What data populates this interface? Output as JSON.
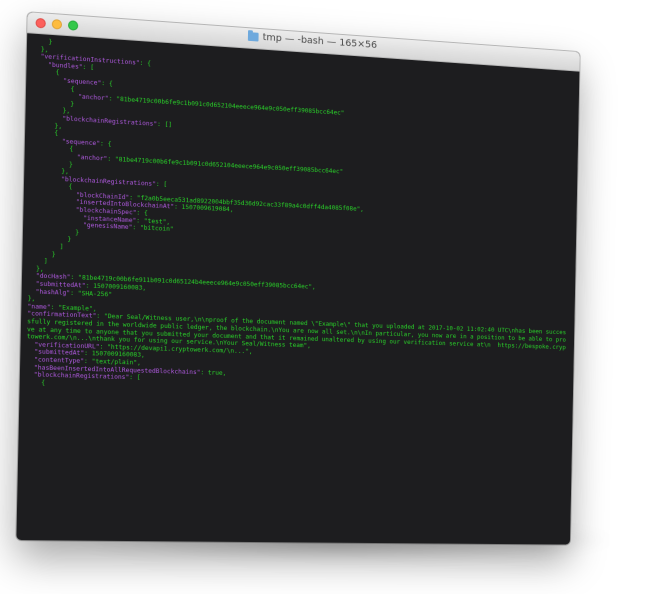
{
  "window": {
    "title": "tmp — -bash — 165×56",
    "icon": "folder-icon",
    "controls": [
      "close",
      "minimize",
      "zoom"
    ]
  },
  "colors": {
    "background": "#1d1d1f",
    "text_green": "#2ad32a",
    "key_purple": "#b05ae0"
  },
  "terminal_lines": [
    "    }",
    "  },",
    "  \"verificationInstructions\": {",
    "    \"bundles\": [",
    "      {",
    "        \"sequence\": {",
    "          {",
    "            \"anchor\": \"81be4719c00b6fe9c1b091c0d652104eeece964e9c050eff39085bcc64ec\"",
    "          }",
    "        },",
    "        \"blockchainRegistrations\": []",
    "      },",
    "      {",
    "        \"sequence\": {",
    "          {",
    "            \"anchor\": \"81be4719c00b6fe9c1b091c0d652104eeece964e9c050eff39085bcc64ec\"",
    "          }",
    "        },",
    "        \"blockchainRegistrations\": [",
    "          {",
    "            \"blockChainId\": \"f2a0b5eeca531ad8922004bbf35d36d92cac33f89a4c0dff4da4085f08e\",",
    "            \"insertedIntoBlockchainAt\": 1507009619084,",
    "            \"blockchainSpec\": {",
    "              \"instanceName\": \"test\",",
    "              \"genesisName\": \"bitcoin\"",
    "            }",
    "          }",
    "        ]",
    "      }",
    "    ]",
    "  },",
    "  \"docHash\": \"81be4719c00b6fe911b091c0d65124b4eeece964e9c050eff39085bcc64ec\",",
    "  \"submittedAt\": 1507009160083,",
    "  \"hashAlg\": \"SHA-256\"",
    "},",
    "\"name\": \"Example\",",
    "\"confirmationText\": \"Dear Seal/Witness user,\\n\\nproof of the document named \\\"Example\\\" that you uploaded at 2017-10-02 11:02:40 UTC\\nhas been successfully registered in the worldwide public ledger, the blockchain.\\nYou are now all set.\\n\\nIn particular, you now are in a position to be able to prove at any time to anyone that you submitted your document and that it remained unaltered by using our verification service at\\n  https://bespoke.cryptowerk.com/\\n...\\nthank you for using our service.\\nYour Seal/Witness team\",",
    "  \"verificationURL\": \"https://devapi1.cryptowerk.com/\\n...\",",
    "  \"submittedAt\": 1507009160083,",
    "  \"contentType\": \"text/plain\",",
    "  \"hasBeenInsertedIntoAllRequestedBlockchains\": true,",
    "  \"blockchainRegistrations\": [",
    "    {"
  ]
}
